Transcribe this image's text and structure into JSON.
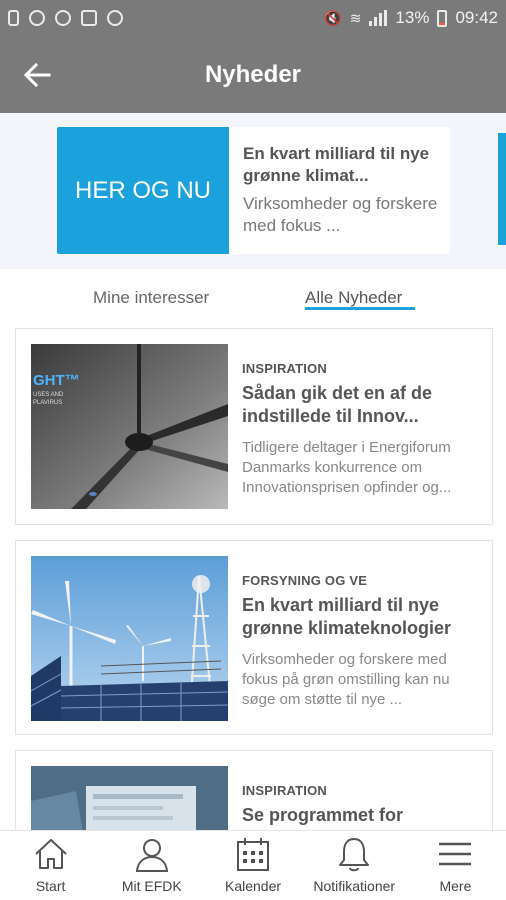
{
  "status_bar": {
    "battery": "13%",
    "time": "09:42",
    "icons": [
      "notification-icon",
      "a-icon",
      "circle-icon",
      "image-icon",
      "cloud-icon",
      "mute-icon",
      "wifi-icon",
      "signal-icon",
      "battery-icon"
    ]
  },
  "toolbar": {
    "title": "Nyheder",
    "back_icon": "arrow-left-icon"
  },
  "banner": {
    "tile_label": "HER OG NU",
    "headline": "En kvart milliard til nye grønne klimat...",
    "body": "Virksomheder og forskere med fokus ...",
    "accent": "#1ba1dc"
  },
  "tabs": {
    "items": [
      {
        "label": "Mine interesser",
        "active": false
      },
      {
        "label": "Alle Nyheder",
        "active": true
      }
    ]
  },
  "articles": [
    {
      "category": "INSPIRATION",
      "title": "Sådan gik det en af de indstillede til Innov...",
      "body": "Tidligere deltager i Energiforum Danmarks konkurrence om Innovationsprisen opfinder og...",
      "thumb_text": "GHT™",
      "thumb_sub": "USES AND PLAVIRUS"
    },
    {
      "category": "FORSYNING OG VE",
      "title": "En kvart milliard til nye grønne klimateknologier",
      "body": "Virksomheder og forskere med fokus på grøn omstilling kan nu søge om støtte til nye ..."
    },
    {
      "category": "INSPIRATION",
      "title": "Se programmet for"
    }
  ],
  "bottom_nav": {
    "items": [
      {
        "label": "Start",
        "icon": "home-icon"
      },
      {
        "label": "Mit EFDK",
        "icon": "user-icon"
      },
      {
        "label": "Kalender",
        "icon": "calendar-icon"
      },
      {
        "label": "Notifikationer",
        "icon": "bell-icon"
      },
      {
        "label": "Mere",
        "icon": "menu-icon"
      }
    ]
  }
}
